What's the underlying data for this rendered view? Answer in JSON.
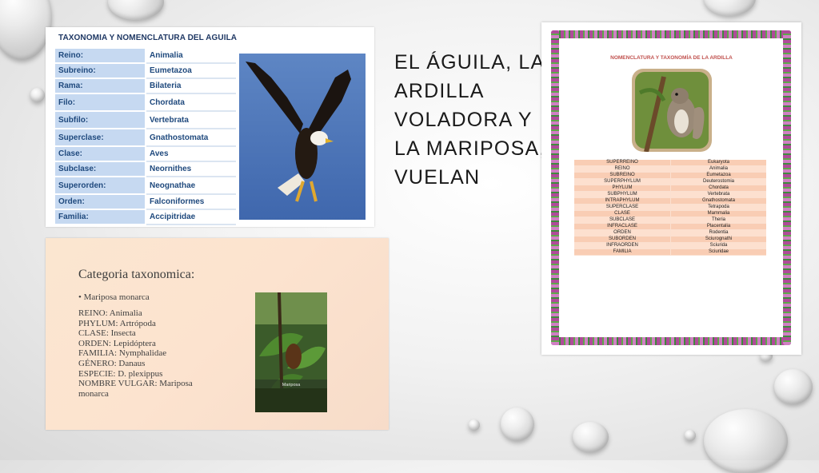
{
  "slide_title": "EL ÁGUILA, LA ARDILLA VOLADORA Y LA MARIPOSA, VUELAN",
  "eagle": {
    "title": "TAXONOMIA Y NOMENCLATURA DEL AGUILA",
    "rows": [
      {
        "k": "Reino:",
        "v": "Animalia"
      },
      {
        "k": "Subreino:",
        "v": "Eumetazoa"
      },
      {
        "k": "Rama:",
        "v": "Bilateria"
      },
      {
        "k": "Filo:",
        "v": "Chordata"
      },
      {
        "k": "Subfilo:",
        "v": "Vertebrata"
      },
      {
        "k": "Superclase:",
        "v": "Gnathostomata"
      },
      {
        "k": "Clase:",
        "v": "Aves"
      },
      {
        "k": "Subclase:",
        "v": "Neornithes"
      },
      {
        "k": "Superorden:",
        "v": "Neognathae"
      },
      {
        "k": "Orden:",
        "v": "Falconiformes"
      },
      {
        "k": "Familia:",
        "v": "Accipitridae"
      }
    ]
  },
  "butterfly": {
    "heading": "Categoria taxonomica:",
    "bullet": "Mariposa monarca",
    "lines": [
      "REINO: Animalia",
      "PHYLUM: Artrópoda",
      "CLASE: Insecta",
      "ORDEN: Lepidóptera",
      "FAMILIA: Nymphalidae",
      "GÉNERO: Danaus",
      "ESPECIE: D. plexippus",
      "NOMBRE VULGAR: Mariposa monarca"
    ],
    "photo_caption": "Mariposa"
  },
  "squirrel": {
    "title": "NOMENCLATURA Y TAXONOMÍA DE LA ARDILLA",
    "rows": [
      {
        "k": "SUPERREINO",
        "v": "Eukaryota"
      },
      {
        "k": "REINO",
        "v": "Animalia"
      },
      {
        "k": "SUBREINO",
        "v": "Eumetazoa"
      },
      {
        "k": "SUPERPHYLUM",
        "v": "Deuterostomia"
      },
      {
        "k": "PHYLUM",
        "v": "Chordata"
      },
      {
        "k": "SUBPHYLUM",
        "v": "Vertebrata"
      },
      {
        "k": "INTRAPHYLUM",
        "v": "Gnathostomata"
      },
      {
        "k": "SUPERCLASE",
        "v": "Tetrapoda"
      },
      {
        "k": "CLASE",
        "v": "Mammalia"
      },
      {
        "k": "SUBCLASE",
        "v": "Theria"
      },
      {
        "k": "INFRACLASE",
        "v": "Placentalia"
      },
      {
        "k": "ORDEN",
        "v": "Rodentia"
      },
      {
        "k": "SUBORDEN",
        "v": "Sciurognathi"
      },
      {
        "k": "INFRAORDEN",
        "v": "Sciurida"
      },
      {
        "k": "FAMILIA",
        "v": "Sciuridae"
      }
    ]
  }
}
